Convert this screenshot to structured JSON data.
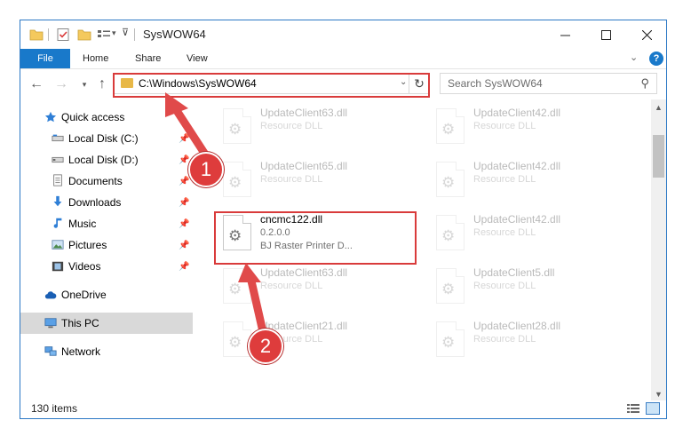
{
  "window": {
    "title": "SysWOW64",
    "minimize_icon": "minimize-icon",
    "maximize_icon": "maximize-icon",
    "close_icon": "close-icon"
  },
  "ribbon": {
    "tabs": [
      "File",
      "Home",
      "Share",
      "View"
    ],
    "accent": "#1979ca"
  },
  "nav": {
    "address": "C:\\Windows\\SysWOW64",
    "search_placeholder": "Search SysWOW64"
  },
  "sidebar": {
    "items": [
      {
        "label": "Quick access",
        "icon": "star-icon",
        "pinned": false
      },
      {
        "label": "Local Disk (C:)",
        "icon": "drive-icon",
        "pinned": true
      },
      {
        "label": "Local Disk (D:)",
        "icon": "drive-icon",
        "pinned": true
      },
      {
        "label": "Documents",
        "icon": "documents-icon",
        "pinned": true
      },
      {
        "label": "Downloads",
        "icon": "downloads-icon",
        "pinned": true
      },
      {
        "label": "Music",
        "icon": "music-icon",
        "pinned": true
      },
      {
        "label": "Pictures",
        "icon": "pictures-icon",
        "pinned": true
      },
      {
        "label": "Videos",
        "icon": "videos-icon",
        "pinned": true
      },
      {
        "label": "OneDrive",
        "icon": "cloud-icon",
        "pinned": false
      },
      {
        "label": "This PC",
        "icon": "computer-icon",
        "pinned": false,
        "selected": true
      },
      {
        "label": "Network",
        "icon": "network-icon",
        "pinned": false
      }
    ]
  },
  "files": [
    {
      "name": "UpdateClient63.dll",
      "line1": "Resource DLL",
      "line2": "",
      "faded": true
    },
    {
      "name": "UpdateClient42.dll",
      "line1": "Resource DLL",
      "line2": "",
      "faded": true
    },
    {
      "name": "UpdateClient65.dll",
      "line1": "Resource DLL",
      "line2": "",
      "faded": true
    },
    {
      "name": "UpdateClient42.dll",
      "line1": "Resource DLL",
      "line2": "",
      "faded": true
    },
    {
      "name": "cncmc122.dll",
      "line1": "0.2.0.0",
      "line2": "BJ Raster Printer D...",
      "faded": false
    },
    {
      "name": "UpdateClient42.dll",
      "line1": "Resource DLL",
      "line2": "",
      "faded": true
    },
    {
      "name": "UpdateClient63.dll",
      "line1": "Resource DLL",
      "line2": "",
      "faded": true
    },
    {
      "name": "UpdateClient5.dll",
      "line1": "Resource DLL",
      "line2": "",
      "faded": true
    },
    {
      "name": "UpdateClient21.dll",
      "line1": "Resource DLL",
      "line2": "",
      "faded": true
    },
    {
      "name": "UpdateClient28.dll",
      "line1": "Resource DLL",
      "line2": "",
      "faded": true
    }
  ],
  "status": {
    "item_count": "130 items"
  },
  "annotations": {
    "markers": [
      "1",
      "2"
    ],
    "highlight_color": "#d93b3b"
  }
}
